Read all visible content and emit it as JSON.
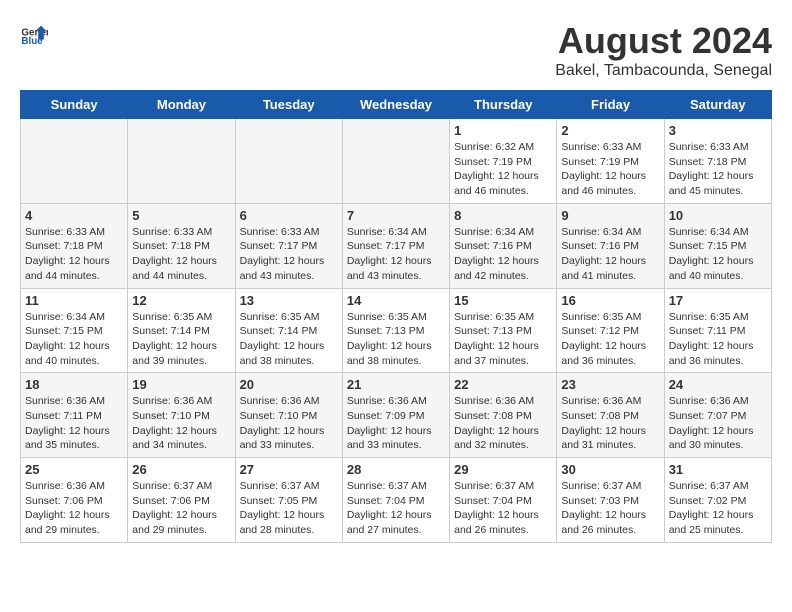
{
  "header": {
    "logo_general": "General",
    "logo_blue": "Blue",
    "title": "August 2024",
    "subtitle": "Bakel, Tambacounda, Senegal"
  },
  "weekdays": [
    "Sunday",
    "Monday",
    "Tuesday",
    "Wednesday",
    "Thursday",
    "Friday",
    "Saturday"
  ],
  "weeks": [
    [
      {
        "day": "",
        "info": ""
      },
      {
        "day": "",
        "info": ""
      },
      {
        "day": "",
        "info": ""
      },
      {
        "day": "",
        "info": ""
      },
      {
        "day": "1",
        "info": "Sunrise: 6:32 AM\nSunset: 7:19 PM\nDaylight: 12 hours\nand 46 minutes."
      },
      {
        "day": "2",
        "info": "Sunrise: 6:33 AM\nSunset: 7:19 PM\nDaylight: 12 hours\nand 46 minutes."
      },
      {
        "day": "3",
        "info": "Sunrise: 6:33 AM\nSunset: 7:18 PM\nDaylight: 12 hours\nand 45 minutes."
      }
    ],
    [
      {
        "day": "4",
        "info": "Sunrise: 6:33 AM\nSunset: 7:18 PM\nDaylight: 12 hours\nand 44 minutes."
      },
      {
        "day": "5",
        "info": "Sunrise: 6:33 AM\nSunset: 7:18 PM\nDaylight: 12 hours\nand 44 minutes."
      },
      {
        "day": "6",
        "info": "Sunrise: 6:33 AM\nSunset: 7:17 PM\nDaylight: 12 hours\nand 43 minutes."
      },
      {
        "day": "7",
        "info": "Sunrise: 6:34 AM\nSunset: 7:17 PM\nDaylight: 12 hours\nand 43 minutes."
      },
      {
        "day": "8",
        "info": "Sunrise: 6:34 AM\nSunset: 7:16 PM\nDaylight: 12 hours\nand 42 minutes."
      },
      {
        "day": "9",
        "info": "Sunrise: 6:34 AM\nSunset: 7:16 PM\nDaylight: 12 hours\nand 41 minutes."
      },
      {
        "day": "10",
        "info": "Sunrise: 6:34 AM\nSunset: 7:15 PM\nDaylight: 12 hours\nand 40 minutes."
      }
    ],
    [
      {
        "day": "11",
        "info": "Sunrise: 6:34 AM\nSunset: 7:15 PM\nDaylight: 12 hours\nand 40 minutes."
      },
      {
        "day": "12",
        "info": "Sunrise: 6:35 AM\nSunset: 7:14 PM\nDaylight: 12 hours\nand 39 minutes."
      },
      {
        "day": "13",
        "info": "Sunrise: 6:35 AM\nSunset: 7:14 PM\nDaylight: 12 hours\nand 38 minutes."
      },
      {
        "day": "14",
        "info": "Sunrise: 6:35 AM\nSunset: 7:13 PM\nDaylight: 12 hours\nand 38 minutes."
      },
      {
        "day": "15",
        "info": "Sunrise: 6:35 AM\nSunset: 7:13 PM\nDaylight: 12 hours\nand 37 minutes."
      },
      {
        "day": "16",
        "info": "Sunrise: 6:35 AM\nSunset: 7:12 PM\nDaylight: 12 hours\nand 36 minutes."
      },
      {
        "day": "17",
        "info": "Sunrise: 6:35 AM\nSunset: 7:11 PM\nDaylight: 12 hours\nand 36 minutes."
      }
    ],
    [
      {
        "day": "18",
        "info": "Sunrise: 6:36 AM\nSunset: 7:11 PM\nDaylight: 12 hours\nand 35 minutes."
      },
      {
        "day": "19",
        "info": "Sunrise: 6:36 AM\nSunset: 7:10 PM\nDaylight: 12 hours\nand 34 minutes."
      },
      {
        "day": "20",
        "info": "Sunrise: 6:36 AM\nSunset: 7:10 PM\nDaylight: 12 hours\nand 33 minutes."
      },
      {
        "day": "21",
        "info": "Sunrise: 6:36 AM\nSunset: 7:09 PM\nDaylight: 12 hours\nand 33 minutes."
      },
      {
        "day": "22",
        "info": "Sunrise: 6:36 AM\nSunset: 7:08 PM\nDaylight: 12 hours\nand 32 minutes."
      },
      {
        "day": "23",
        "info": "Sunrise: 6:36 AM\nSunset: 7:08 PM\nDaylight: 12 hours\nand 31 minutes."
      },
      {
        "day": "24",
        "info": "Sunrise: 6:36 AM\nSunset: 7:07 PM\nDaylight: 12 hours\nand 30 minutes."
      }
    ],
    [
      {
        "day": "25",
        "info": "Sunrise: 6:36 AM\nSunset: 7:06 PM\nDaylight: 12 hours\nand 29 minutes."
      },
      {
        "day": "26",
        "info": "Sunrise: 6:37 AM\nSunset: 7:06 PM\nDaylight: 12 hours\nand 29 minutes."
      },
      {
        "day": "27",
        "info": "Sunrise: 6:37 AM\nSunset: 7:05 PM\nDaylight: 12 hours\nand 28 minutes."
      },
      {
        "day": "28",
        "info": "Sunrise: 6:37 AM\nSunset: 7:04 PM\nDaylight: 12 hours\nand 27 minutes."
      },
      {
        "day": "29",
        "info": "Sunrise: 6:37 AM\nSunset: 7:04 PM\nDaylight: 12 hours\nand 26 minutes."
      },
      {
        "day": "30",
        "info": "Sunrise: 6:37 AM\nSunset: 7:03 PM\nDaylight: 12 hours\nand 26 minutes."
      },
      {
        "day": "31",
        "info": "Sunrise: 6:37 AM\nSunset: 7:02 PM\nDaylight: 12 hours\nand 25 minutes."
      }
    ]
  ]
}
